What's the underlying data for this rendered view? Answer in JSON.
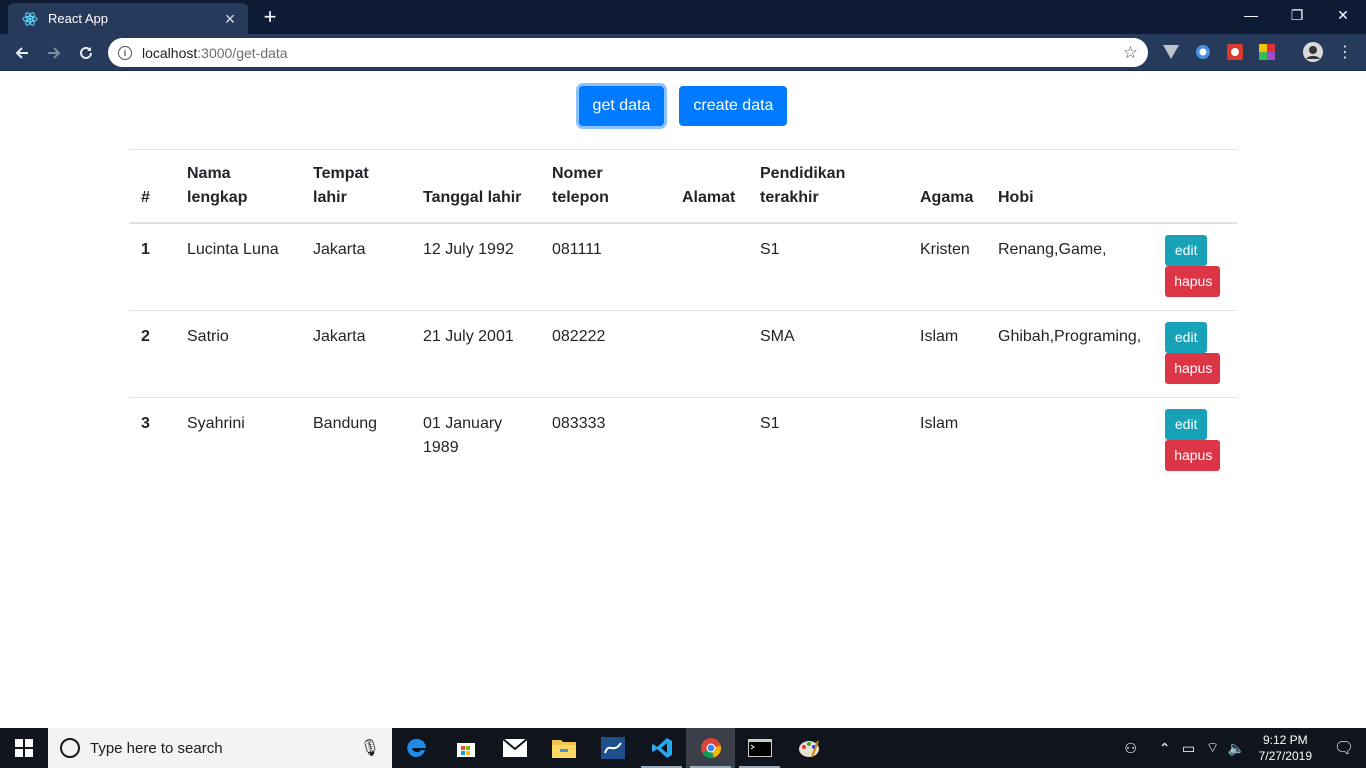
{
  "browser": {
    "tab_title": "React App",
    "tab_close": "×",
    "new_tab": "+",
    "url_host": "localhost",
    "url_path": ":3000/get-data",
    "minimize": "—",
    "restore": "❐",
    "close": "✕"
  },
  "page": {
    "get_button": "get data",
    "create_button": "create data"
  },
  "table": {
    "headers": {
      "num": "#",
      "nama_1": "Nama",
      "nama_2": "lengkap",
      "tempat_1": "Tempat",
      "tempat_2": "lahir",
      "tanggal": "Tanggal lahir",
      "telepon_1": "Nomer",
      "telepon_2": "telepon",
      "alamat": "Alamat",
      "pendidikan_1": "Pendidikan",
      "pendidikan_2": "terakhir",
      "agama": "Agama",
      "hobi": "Hobi"
    },
    "rows": [
      {
        "num": "1",
        "nama": "Lucinta Luna",
        "tempat": "Jakarta",
        "tanggal": "12 July 1992",
        "telepon": "081111",
        "alamat": "",
        "pendidikan": "S1",
        "agama": "Kristen",
        "hobi": "Renang,Game,",
        "edit": "edit",
        "hapus": "hapus"
      },
      {
        "num": "2",
        "nama": "Satrio",
        "tempat": "Jakarta",
        "tanggal": "21 July 2001",
        "telepon": "082222",
        "alamat": "",
        "pendidikan": "SMA",
        "agama": "Islam",
        "hobi": "Ghibah,Programing,",
        "edit": "edit",
        "hapus": "hapus"
      },
      {
        "num": "3",
        "nama": "Syahrini",
        "tempat": "Bandung",
        "tanggal": "01 January 1989",
        "telepon": "083333",
        "alamat": "",
        "pendidikan": "S1",
        "agama": "Islam",
        "hobi": "",
        "edit": "edit",
        "hapus": "hapus"
      }
    ]
  },
  "taskbar": {
    "search_placeholder": "Type here to search",
    "time": "9:12 PM",
    "date": "7/27/2019"
  },
  "colors": {
    "primary": "#007bff",
    "info": "#17a2b8",
    "danger": "#dc3545",
    "titlebar": "#0d1b34",
    "toolbar": "#263a5c"
  }
}
